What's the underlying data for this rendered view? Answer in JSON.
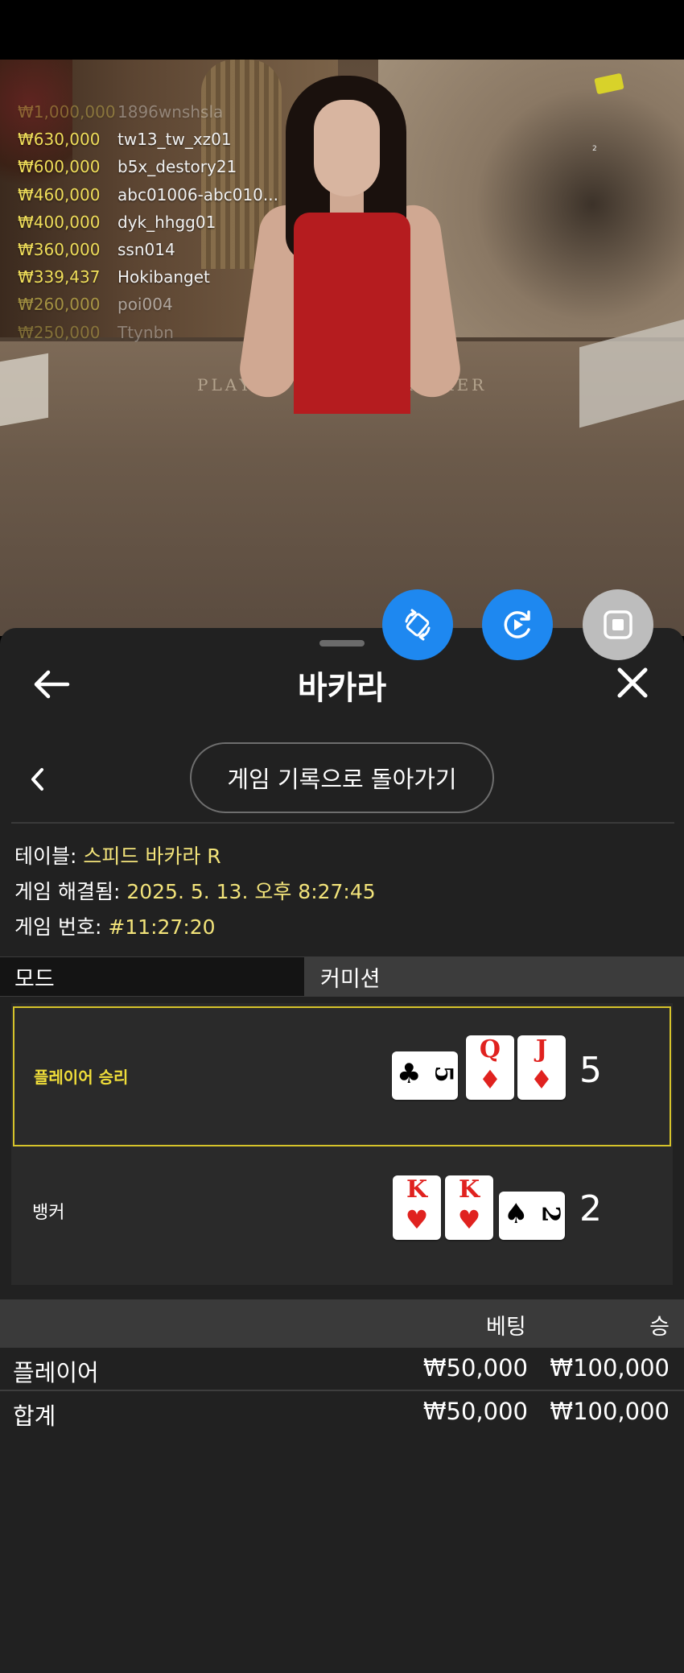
{
  "leaderboard": [
    {
      "amount": "₩1,000,000",
      "name": "1896wnshsla"
    },
    {
      "amount": "₩630,000",
      "name": "tw13_tw_xz01"
    },
    {
      "amount": "₩600,000",
      "name": "b5x_destory21"
    },
    {
      "amount": "₩460,000",
      "name": "abc01006-abc010..."
    },
    {
      "amount": "₩400,000",
      "name": "dyk_hhgg01"
    },
    {
      "amount": "₩360,000",
      "name": "ssn014"
    },
    {
      "amount": "₩339,437",
      "name": "Hokibanget"
    },
    {
      "amount": "₩260,000",
      "name": "poi004"
    },
    {
      "amount": "₩250,000",
      "name": "Ttynbn"
    }
  ],
  "video": {
    "felt_player": "PLAYER",
    "felt_banker": "BANKER",
    "small_marker": "2"
  },
  "sheet": {
    "title": "바카라",
    "return_button": "게임 기록으로 돌아가기",
    "info": {
      "table_label": "테이블: ",
      "table_value": "스피드 바카라 R",
      "resolved_label": "게임 해결됨: ",
      "resolved_value": "2025. 5. 13. 오후 8:27:45",
      "number_label": "게임 번호: ",
      "number_value": "#11:27:20"
    },
    "mode_label": "모드",
    "commission_label": "커미션"
  },
  "result": {
    "player_label": "플레이어 승리",
    "player_score": "5",
    "player_cards": [
      {
        "rank": "5",
        "suit": "♣",
        "color": "black",
        "orientation": "horizontal"
      },
      {
        "rank": "Q",
        "suit": "♦",
        "color": "red",
        "orientation": "vertical"
      },
      {
        "rank": "J",
        "suit": "♦",
        "color": "red",
        "orientation": "vertical"
      }
    ],
    "banker_label": "뱅커",
    "banker_score": "2",
    "banker_cards": [
      {
        "rank": "K",
        "suit": "♥",
        "color": "red",
        "orientation": "vertical"
      },
      {
        "rank": "K",
        "suit": "♥",
        "color": "red",
        "orientation": "vertical"
      },
      {
        "rank": "2",
        "suit": "♠",
        "color": "black",
        "orientation": "horizontal"
      }
    ]
  },
  "bets": {
    "header_bet": "베팅",
    "header_win": "승",
    "rows": [
      {
        "label": "플레이어",
        "bet": "₩50,000",
        "win": "₩100,000"
      },
      {
        "label": "합계",
        "bet": "₩50,000",
        "win": "₩100,000"
      }
    ]
  },
  "icons": {
    "fab1": "swap-table-icon",
    "fab2": "replay-icon",
    "fab3": "stop-icon",
    "back": "arrow-left-icon",
    "close": "close-icon",
    "chevron": "chevron-left-icon"
  },
  "colors": {
    "accent_gold": "#d6c32a",
    "fab_blue": "#1e88f0",
    "amount_yellow": "#f0de5a"
  }
}
